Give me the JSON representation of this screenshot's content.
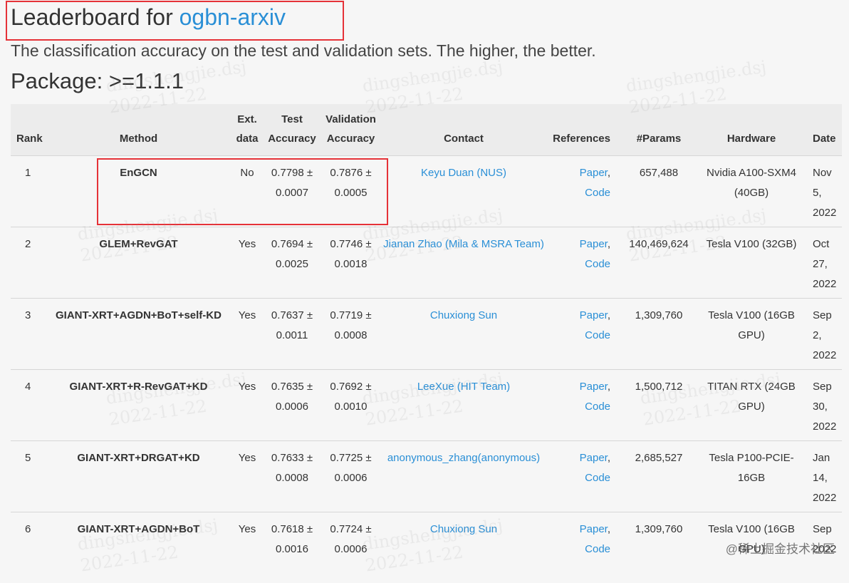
{
  "page": {
    "title_prefix": "Leaderboard for ",
    "dataset_link": "ogbn-arxiv",
    "subtitle": "The classification accuracy on the test and validation sets. The higher, the better.",
    "package": "Package: >=1.1.1"
  },
  "table": {
    "headers": {
      "rank": "Rank",
      "method": "Method",
      "ext_line1": "Ext.",
      "ext_line2": "data",
      "test_line1": "Test",
      "test_line2": "Accuracy",
      "val_line1": "Validation",
      "val_line2": "Accuracy",
      "contact": "Contact",
      "references": "References",
      "params": "#Params",
      "hardware": "Hardware",
      "date": "Date"
    },
    "rows": [
      {
        "rank": "1",
        "method": "EnGCN",
        "ext": "No",
        "test": "0.7798 ± 0.0007",
        "val": "0.7876 ± 0.0005",
        "contact": "Keyu Duan (NUS)",
        "paper": "Paper",
        "code": "Code",
        "params": "657,488",
        "hardware": "Nvidia A100-SXM4 (40GB)",
        "date": "Nov 5, 2022"
      },
      {
        "rank": "2",
        "method": "GLEM+RevGAT",
        "ext": "Yes",
        "test": "0.7694 ± 0.0025",
        "val": "0.7746 ± 0.0018",
        "contact": "Jianan Zhao (Mila & MSRA Team)",
        "paper": "Paper",
        "code": "Code",
        "params": "140,469,624",
        "hardware": "Tesla V100 (32GB)",
        "date": "Oct 27, 2022"
      },
      {
        "rank": "3",
        "method": "GIANT-XRT+AGDN+BoT+self-KD",
        "ext": "Yes",
        "test": "0.7637 ± 0.0011",
        "val": "0.7719 ± 0.0008",
        "contact": "Chuxiong Sun",
        "paper": "Paper",
        "code": "Code",
        "params": "1,309,760",
        "hardware": "Tesla V100 (16GB GPU)",
        "date": "Sep 2, 2022"
      },
      {
        "rank": "4",
        "method": "GIANT-XRT+R-RevGAT+KD",
        "ext": "Yes",
        "test": "0.7635 ± 0.0006",
        "val": "0.7692 ± 0.0010",
        "contact": "LeeXue (HIT Team)",
        "paper": "Paper",
        "code": "Code",
        "params": "1,500,712",
        "hardware": "TITAN RTX (24GB GPU)",
        "date": "Sep 30, 2022"
      },
      {
        "rank": "5",
        "method": "GIANT-XRT+DRGAT+KD",
        "ext": "Yes",
        "test": "0.7633 ± 0.0008",
        "val": "0.7725 ± 0.0006",
        "contact": "anonymous_zhang(anonymous)",
        "paper": "Paper",
        "code": "Code",
        "params": "2,685,527",
        "hardware": "Tesla P100-PCIE-16GB",
        "date": "Jan 14, 2022"
      },
      {
        "rank": "6",
        "method": "GIANT-XRT+AGDN+BoT",
        "ext": "Yes",
        "test": "0.7618 ± 0.0016",
        "val": "0.7724 ± 0.0006",
        "contact": "Chuxiong Sun",
        "paper": "Paper",
        "code": "Code",
        "params": "1,309,760",
        "hardware": "Tesla V100 (16GB GPU)",
        "date": "Sep 2022"
      }
    ]
  },
  "watermark": {
    "name": "dingshengjie.dsj",
    "date": "2022-11-22",
    "corner": "@稀土掘金技术社区"
  },
  "colors": {
    "link": "#2a8fd6",
    "highlight_box": "#e53238",
    "background": "#f6f6f6",
    "header_background": "#ececec"
  }
}
